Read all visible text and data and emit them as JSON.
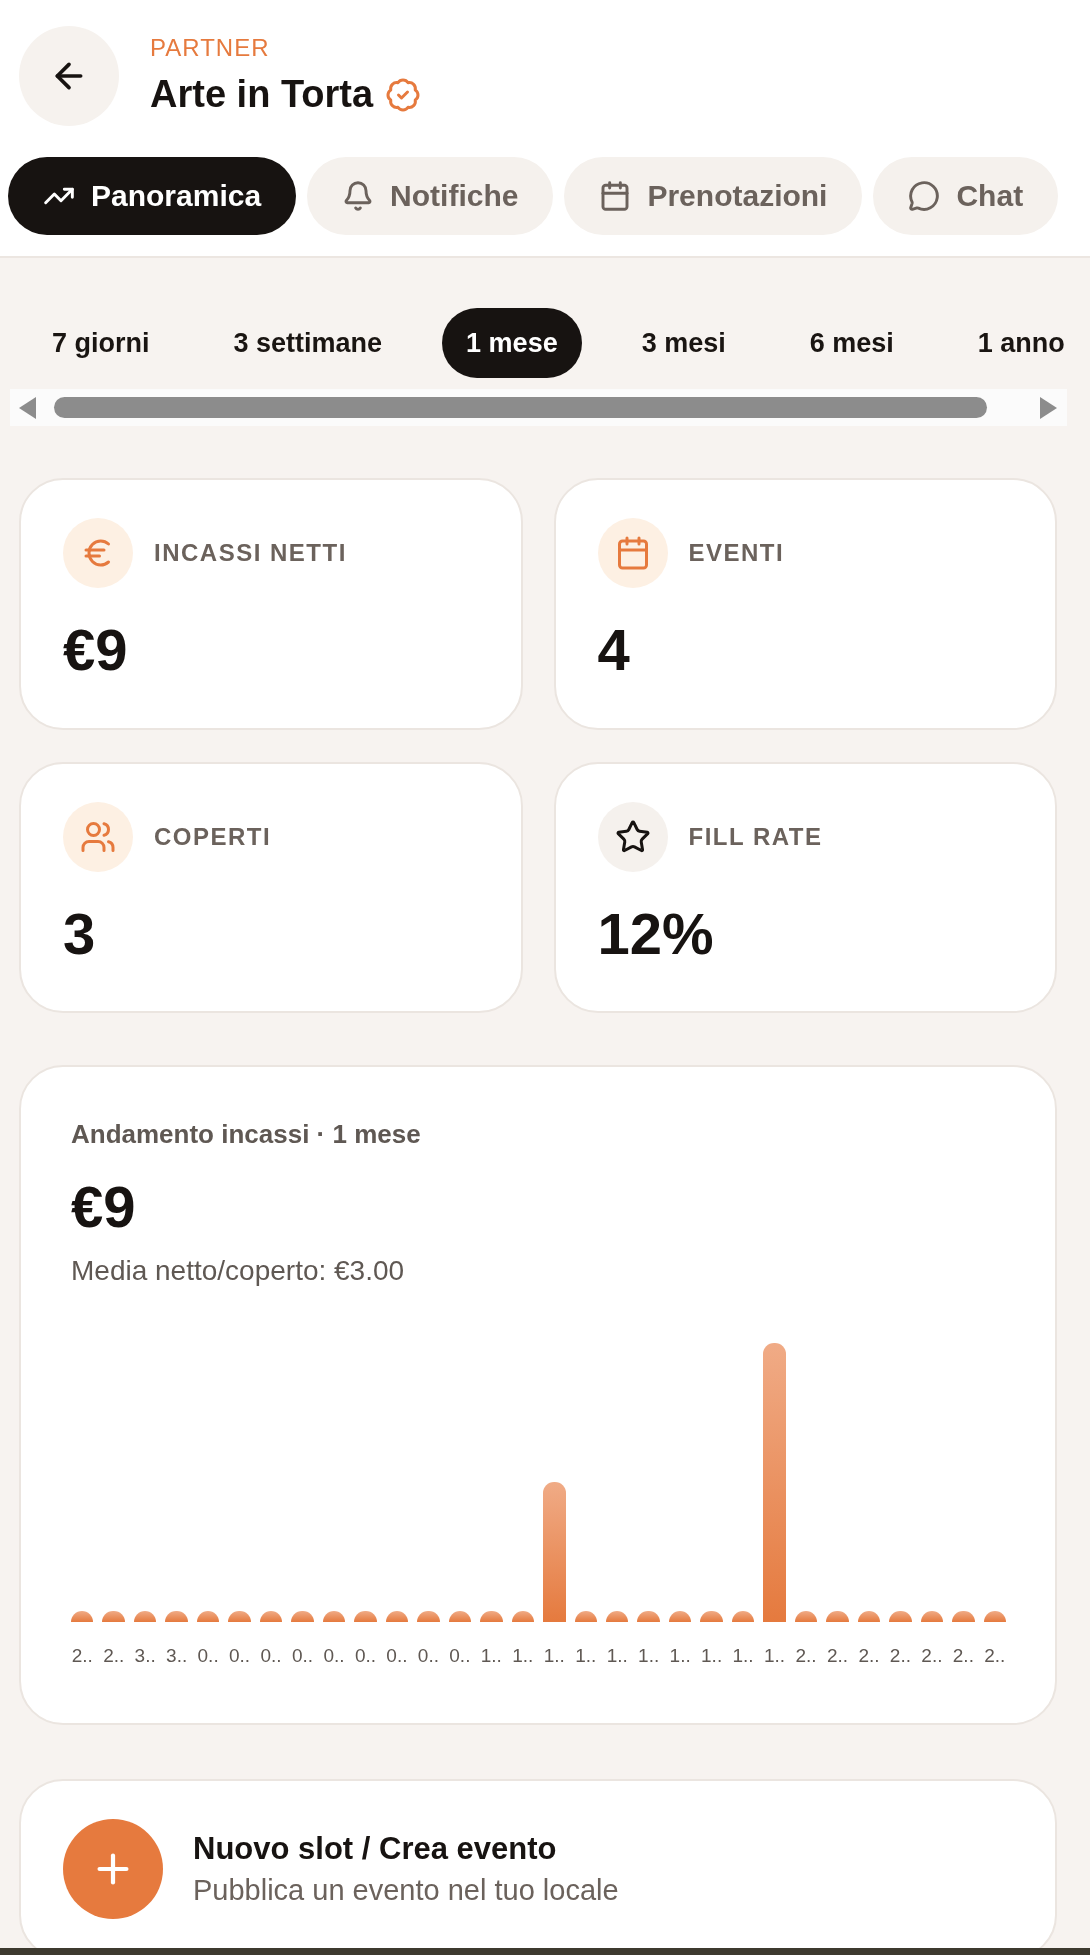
{
  "header": {
    "eyebrow": "PARTNER",
    "title": "Arte in Torta",
    "verified": true
  },
  "tabs": [
    {
      "label": "Panoramica",
      "selected": true
    },
    {
      "label": "Notifiche",
      "selected": false
    },
    {
      "label": "Prenotazioni",
      "selected": false
    },
    {
      "label": "Chat",
      "selected": false
    }
  ],
  "periods": [
    {
      "label": "7 giorni",
      "selected": false
    },
    {
      "label": "3 settimane",
      "selected": false
    },
    {
      "label": "1 mese",
      "selected": true
    },
    {
      "label": "3 mesi",
      "selected": false
    },
    {
      "label": "6 mesi",
      "selected": false
    },
    {
      "label": "1 anno",
      "selected": false
    }
  ],
  "stats": [
    {
      "label": "INCASSI NETTI",
      "value": "€9",
      "kind": "accent"
    },
    {
      "label": "EVENTI",
      "value": "4",
      "kind": "accent"
    },
    {
      "label": "COPERTI",
      "value": "3",
      "kind": "accent"
    },
    {
      "label": "FILL RATE",
      "value": "12%",
      "kind": "neutral"
    }
  ],
  "revenue_chart": {
    "title": "Andamento incassi · 1 mese",
    "total": "€9",
    "average": "Media netto/coperto: €3.00",
    "x_labels": [
      "2..",
      "2..",
      "3..",
      "3..",
      "0..",
      "0..",
      "0..",
      "0..",
      "0..",
      "0..",
      "0..",
      "0..",
      "0..",
      "1..",
      "1..",
      "1..",
      "1..",
      "1..",
      "1..",
      "1..",
      "1..",
      "1..",
      "1..",
      "2..",
      "2..",
      "2..",
      "2..",
      "2..",
      "2..",
      "2.."
    ]
  },
  "action_card": {
    "title": "Nuovo slot / Crea evento",
    "subtitle": "Pubblica un evento nel tuo locale"
  }
}
